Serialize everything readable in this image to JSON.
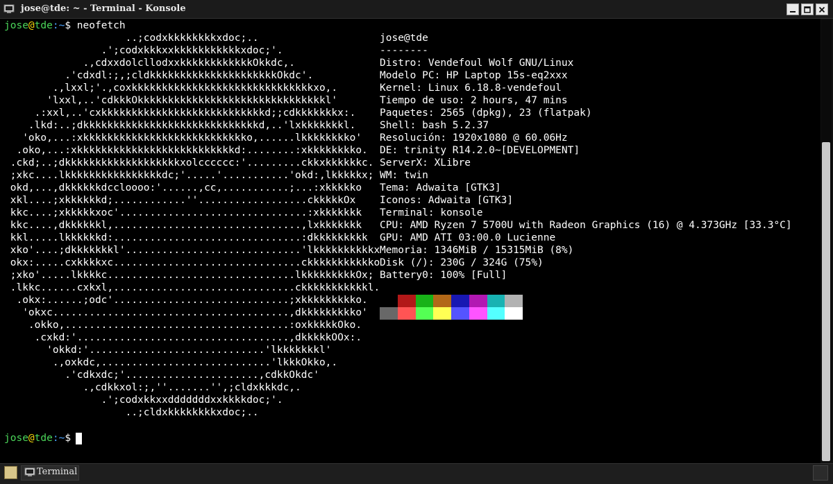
{
  "window": {
    "title": "jose@tde: ~ - Terminal - Konsole",
    "icon": "terminal-icon",
    "buttons": [
      "minimize-icon",
      "maximize-icon",
      "close-icon"
    ]
  },
  "terminal": {
    "prompt": {
      "user": "jose",
      "at": "@",
      "host": "tde",
      "path": ":~",
      "symbol": "$"
    },
    "command": "neofetch",
    "ascii_art": [
      "                    ..;codxkkkkkkkkxdoc;..",
      "                .';codxkkkxxkkkkkkkkkkkxdoc;'.",
      "             .,cdxxdolcllodxxkkkkkkkkkkkkOkkdc,.",
      "          .'cdxdl:;,;cldkkkkkkkkkkkkkkkkkkkkkOkdc'.",
      "        .,lxxl;'.,coxkkkkkkkkkkkkkkkkkkkkkkkkkkkkkkxo,.",
      "       'lxxl,..'cdkkkOkkkkkkkkkkkkkkkkkkkkkkkkkkkkkkkl'",
      "     .:xxl,..'cxkkkkkkkkkkkkkkkkkkkkkkkkkkkd;;cdkkkkkkkx:.",
      "    .lkd:..;dkkkkkkkkkkkkkkkkkkkkkkkkkkkkkd,..'lxkkkkkkkl.",
      "   'oko,...:xkkkkkkkkkkkkkkkkkkkkkkkkkkko,......lkkkkkkkko'",
      "  .oko,...:xkkkkkkkkkkkkkkkkkkkkkkkkkkd:........:xkkkkkkkko.",
      " .ckd;..;dkkkkkkkkkkkkkkkkkkkxolcccccc:'.........ckkxkkkkkkc.",
      " ;xkc....lkkkkkkkkkkkkkkkkdc;'.....'...........'okd:,lkkkkkx;",
      " okd,...,dkkkkkkdccloooo:'......,cc,...........;...:xkkkkko",
      " xkl....;xkkkkkkd;............''..................ckkkkkOx",
      " kkc....;xkkkkkxoc'...............................:xkkkkkkk",
      " kkc....,dkkkkkkl,...............................,lxkkkkkkk",
      " kkl.....lkkkkkkd:...............................:dkkkkkkkkk",
      " xko'....;dkkkkkkkl'.............................'lkkkkkkkkkkx",
      " okx:.....cxkkkkxc...............................ckkkkkkkkkkko",
      " ;xko'.....lkkkkc...............................lkkkkkkkkkOx;",
      " .lkkc......cxkxl,..............................ckkkkkkkkkkkl.",
      "  .okx:......;odc'.............................;xkkkkkkkkko.",
      "   'okxc.......................................,dkkkkkkkkko'",
      "    .okko,.....................................:oxkkkkkOko.",
      "     .cxkd:'...................................,dkkkkkOOx:.",
      "       'okkd:'.............................'lkkkkkkkl'",
      "        .,oxkdc,............................'lkkkOkko,.",
      "          .'cdkxdc;'......................,cdkkOkdc'",
      "             .,cdkkxol:;,''.......'',;cldxkkkdc,.",
      "                .';codxkkxxdddddddxxkkkkdoc;'.",
      "                    ..;cldxkkkkkkkkxdoc;.."
    ],
    "info_header": "jose@tde",
    "info_separator": "--------",
    "info": [
      {
        "key": "Distro",
        "value": "Vendefoul Wolf GNU/Linux"
      },
      {
        "key": "Modelo PC",
        "value": "HP Laptop 15s-eq2xxx"
      },
      {
        "key": "Kernel",
        "value": "Linux 6.18.8-vendefoul"
      },
      {
        "key": "Tiempo de uso",
        "value": "2 hours, 47 mins"
      },
      {
        "key": "Paquetes",
        "value": "2565 (dpkg), 23 (flatpak)"
      },
      {
        "key": "Shell",
        "value": "bash 5.2.37"
      },
      {
        "key": "Resolución",
        "value": "1920x1080 @ 60.06Hz"
      },
      {
        "key": "DE",
        "value": "trinity R14.2.0~[DEVELOPMENT]"
      },
      {
        "key": "ServerX",
        "value": "XLibre"
      },
      {
        "key": "WM",
        "value": "twin"
      },
      {
        "key": "Tema",
        "value": "Adwaita [GTK3]"
      },
      {
        "key": "Iconos",
        "value": "Adwaita [GTK3]"
      },
      {
        "key": "Terminal",
        "value": "konsole"
      },
      {
        "key": "CPU",
        "value": "AMD Ryzen 7 5700U with Radeon Graphics (16) @ 4.373GHz [33.3°C]"
      },
      {
        "key": "GPU",
        "value": "AMD ATI 03:00.0 Lucienne"
      },
      {
        "key": "Memoria",
        "value": "1346MiB / 15315MiB (8%)"
      },
      {
        "key": "Disk (/)",
        "value": "230G / 324G (75%)"
      },
      {
        "key": "Battery0",
        "value": "100% [Full]"
      }
    ],
    "palette_dark": [
      "#000000",
      "#b21818",
      "#18b218",
      "#b26818",
      "#1818b2",
      "#b218b2",
      "#18b2b2",
      "#b2b2b2"
    ],
    "palette_bright": [
      "#686868",
      "#ff5454",
      "#54ff54",
      "#ffff54",
      "#5454ff",
      "#ff54ff",
      "#54ffff",
      "#ffffff"
    ]
  },
  "taskbar": {
    "task_label": "Terminal"
  },
  "colors": {
    "prompt_user": "#4bd65a",
    "prompt_at": "#f2d40b",
    "prompt_path": "#4aa3ff"
  }
}
